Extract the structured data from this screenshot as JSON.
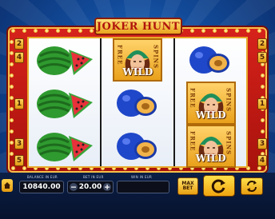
{
  "game": {
    "title": "JOKER HUNT"
  },
  "paylines": {
    "left": [
      "2",
      "4",
      "1",
      "3",
      "5"
    ],
    "right": [
      "2",
      "5",
      "1",
      "3",
      "4"
    ]
  },
  "reels": [
    [
      "watermelon",
      "watermelon",
      "watermelon"
    ],
    [
      "wild",
      "plum",
      "plum"
    ],
    [
      "plum",
      "wild",
      "wild"
    ]
  ],
  "wild_symbol": {
    "word": "WILD",
    "free_text": "FREE",
    "spins_text": "SPINS"
  },
  "bottom_bar": {
    "balance_label": "BALANCE IN EUR",
    "balance_value": "10840.00",
    "bet_label": "BET IN EUR",
    "bet_value": "20.00",
    "win_label": "WIN IN EUR",
    "win_value": "",
    "max_bet_line1": "MAX",
    "max_bet_line2": "BET"
  },
  "colors": {
    "frame_red": "#d6221b",
    "gold": "#f6c04a",
    "plum": "#1f47c9",
    "melon_green": "#2f9a2f"
  },
  "icons": {
    "home": "home-icon",
    "minus": "minus-icon",
    "plus": "plus-icon",
    "spin": "spin-arrow-icon",
    "autoplay": "autoplay-icon"
  }
}
